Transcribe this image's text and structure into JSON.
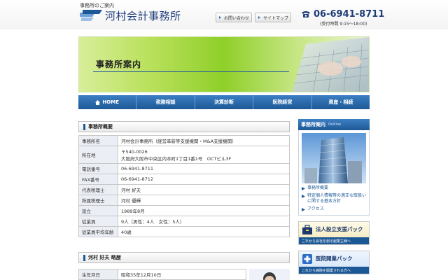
{
  "header": {
    "tagline": "事務所のご案内",
    "firm_name": "河村会計事務所",
    "links": [
      {
        "label": "お問い合わせ"
      },
      {
        "label": "サイトマップ"
      }
    ],
    "phone": "06-6941-8711",
    "hours": "(受付時間 9:15〜18:00)"
  },
  "banner": {
    "title": "事務所案内"
  },
  "nav": {
    "items": [
      "HOME",
      "税務相談",
      "決算診断",
      "医院経営",
      "資産・相続"
    ]
  },
  "overview": {
    "heading": "事務所概要",
    "rows": [
      {
        "key": "事務所名",
        "value": "河村会計事務所（経営革新等支援機関・M&A支援機関）"
      },
      {
        "key": "所在地",
        "value": "〒540-0026",
        "value2": "大阪府大阪市中央区内本町1丁目1番1号　OCTビル3F"
      },
      {
        "key": "電話番号",
        "value": "06-6941-8711"
      },
      {
        "key": "FAX番号",
        "value": "06-6941-8712"
      },
      {
        "key": "代表税理士",
        "value": "河村 好夫"
      },
      {
        "key": "所属税理士",
        "value": "河村 優輝"
      },
      {
        "key": "設立",
        "value": "1989年8月"
      },
      {
        "key": "従業員",
        "value": "9人（男性：4人　女性：5人）"
      },
      {
        "key": "従業員平均年齢",
        "value": "40歳"
      }
    ]
  },
  "bio": {
    "heading": "河村 好夫 略歴",
    "rows": [
      {
        "key": "生年月日",
        "value": "昭和35年12月10日"
      }
    ]
  },
  "sidebar": {
    "title": "事務所案内",
    "subtitle": "Outline",
    "links": [
      "事務所概要",
      "特定個人情報等の適正な取扱いに関する基本方針",
      "アクセス"
    ],
    "promos": [
      {
        "title": "法人設立支援パック",
        "sub": "これから会社を創る起業主様へ"
      },
      {
        "title": "医院開業パック",
        "sub": "これから病院を開業される方へ"
      }
    ]
  },
  "colors": {
    "navy": "#1f3d7a",
    "nav_blue": "#1d5896",
    "banner_green": "#8fcf2a"
  }
}
